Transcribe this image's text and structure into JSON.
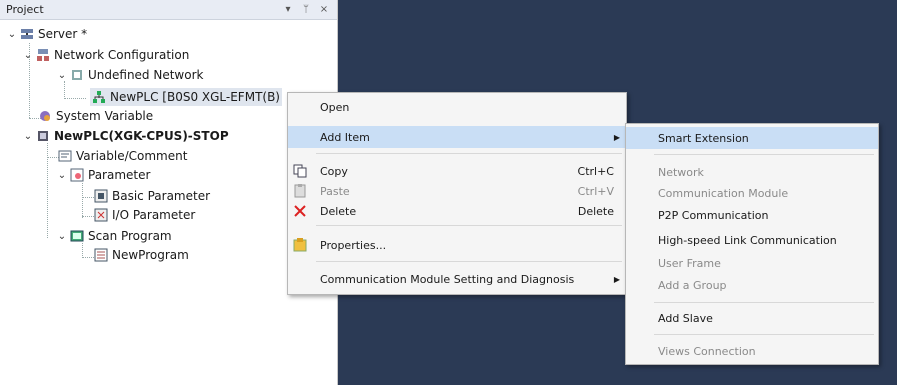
{
  "panel": {
    "title": "Project",
    "pin_glyph": "▾",
    "dock_glyph": "ᛘ",
    "close_glyph": "×"
  },
  "tree": {
    "server": "Server *",
    "network_config": "Network Configuration",
    "undefined_network": "Undefined Network",
    "newplc_node": "NewPLC [B0S0 XGL-EFMT(B)",
    "system_variable": "System Variable",
    "cpu": "NewPLC(XGK-CPUS)-STOP",
    "variable_comment": "Variable/Comment",
    "parameter": "Parameter",
    "basic_parameter": "Basic Parameter",
    "io_parameter": "I/O Parameter",
    "scan_program": "Scan Program",
    "new_program": "NewProgram"
  },
  "context_menu": {
    "open": "Open",
    "add_item": "Add Item",
    "copy": "Copy",
    "copy_shortcut": "Ctrl+C",
    "paste": "Paste",
    "paste_shortcut": "Ctrl+V",
    "delete": "Delete",
    "delete_shortcut": "Delete",
    "properties": "Properties...",
    "comm_setting": "Communication Module Setting and Diagnosis"
  },
  "submenu": {
    "smart_extension": "Smart Extension",
    "network": "Network",
    "communication_module": "Communication Module",
    "p2p": "P2P Communication",
    "highspeed": "High-speed Link Communication",
    "user_frame": "User Frame",
    "add_group": "Add a Group",
    "add_slave": "Add Slave",
    "views_connection": "Views Connection"
  },
  "colors": {
    "background": "#2b3a55",
    "highlight": "#c9def5",
    "disabled": "#8a8a8a"
  }
}
